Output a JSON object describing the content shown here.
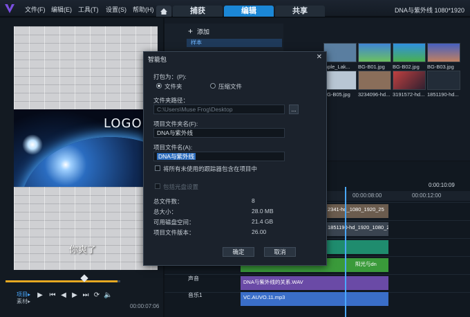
{
  "app": {
    "menu": [
      "文件(F)",
      "编辑(E)",
      "工具(T)",
      "设置(S)",
      "帮助(H)"
    ],
    "tabs": [
      "捕获",
      "编辑",
      "共享"
    ],
    "active_tab": "编辑",
    "project_info": "DNA与紫外线  1080*1920"
  },
  "preview": {
    "logo_text": "LOGO",
    "caption_text": "你爽了",
    "project_label": "项目▸",
    "clip_label": "素材▸",
    "timecode": "00:00:07:06"
  },
  "library": {
    "add_label": "添加",
    "folder_label": "样本",
    "thumbnails": [
      {
        "name": "mple_Lak...",
        "color": "#5a7ea0"
      },
      {
        "name": "BG-B01.jpg",
        "color": "#3f85d6"
      },
      {
        "name": "BG-B02.jpg",
        "color": "#2f8fe0"
      },
      {
        "name": "BG-B03.jpg",
        "color": "#4660c0"
      },
      {
        "name": "BG-B05.jpg",
        "color": "#b8c6d4"
      },
      {
        "name": "3234096-hd...",
        "color": "#8a6e5a"
      },
      {
        "name": "3191572-hd...",
        "color": "#c04040"
      },
      {
        "name": "1851190-hd...",
        "color": "#222c38"
      }
    ]
  },
  "timeline": {
    "ruler": [
      "00:00:08:00",
      "00:00:12:00"
    ],
    "timecode": "0:00:10:09",
    "tracks": [
      {
        "label": "",
        "clip": "2341-hd_1080_1920_25",
        "color": "#6b5c4e"
      },
      {
        "label": "",
        "clip": "1851190-hd_1920_1080_25",
        "color": "#3a4450"
      },
      {
        "label": "",
        "clip": "",
        "color": "#1f8c6e"
      },
      {
        "label": "",
        "clip": "阳光与dn",
        "color": "#3a9a3a"
      },
      {
        "label": "声音",
        "clip": "DNA与紫外线的关系.WAV",
        "color": "#6a4aa6"
      },
      {
        "label": "音乐1",
        "clip": "VC.AUVO.11.mp3",
        "color": "#3a6ec8"
      }
    ]
  },
  "dialog": {
    "title": "智能包",
    "package_as_label": "打包为：(P):",
    "option_folder": "文件夹",
    "option_zip": "压缩文件",
    "folder_path_label": "文件夹路径：",
    "folder_path": "C:\\Users\\Muse Frog\\Desktop",
    "browse_label": "...",
    "project_folder_label": "项目文件夹名(F):",
    "project_folder": "DNA与紫外线",
    "project_file_label": "项目文件名(A):",
    "project_file": "DNA与紫外线",
    "include_unused_label": "将所有未使用的跟踪器包含在项目中",
    "include_disc_label": "包括光盘设置",
    "stats": [
      {
        "label": "总文件数：",
        "value": "8"
      },
      {
        "label": "总大小：",
        "value": "28.0 MB"
      },
      {
        "label": "可用磁盘空间：",
        "value": "21.4 GB"
      },
      {
        "label": "项目文件版本：",
        "value": "26.00"
      }
    ],
    "ok_label": "确定",
    "cancel_label": "取消"
  }
}
